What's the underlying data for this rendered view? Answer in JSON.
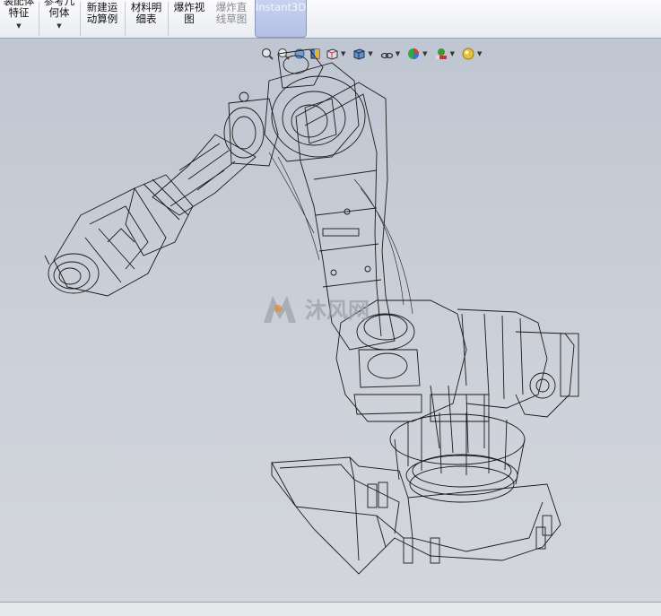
{
  "ribbon": {
    "buttons": [
      {
        "id": "assembly-feature",
        "label": "装配体\n特征",
        "has_dropdown": true
      },
      {
        "id": "reference-geometry",
        "label": "参考几\n何体",
        "has_dropdown": true
      },
      {
        "id": "new-motion-study",
        "label": "新建运\n动算例",
        "has_dropdown": false
      },
      {
        "id": "bill-of-materials",
        "label": "材料明\n细表",
        "has_dropdown": false
      },
      {
        "id": "exploded-view",
        "label": "爆炸视\n图",
        "has_dropdown": false
      },
      {
        "id": "explode-line-sketch",
        "label": "爆炸直\n线草图",
        "has_dropdown": false
      },
      {
        "id": "instant3d",
        "label": "Instant3D",
        "has_dropdown": false
      }
    ]
  },
  "view_toolbar": {
    "icons": [
      "zoom-to-fit-icon",
      "zoom-to-area-icon",
      "previous-view-icon",
      "section-view-icon",
      "view-orientation-icon",
      "display-style-icon",
      "hide-show-items-icon",
      "edit-appearance-icon",
      "apply-scene-icon",
      "view-settings-icon"
    ]
  },
  "watermark": {
    "text": "沐风网"
  },
  "colors": {
    "viewport_top": "#c0c6d2",
    "viewport_bottom": "#d3d6dc",
    "wire": "#1a1a1a",
    "active_button": "#b4c0e6"
  }
}
